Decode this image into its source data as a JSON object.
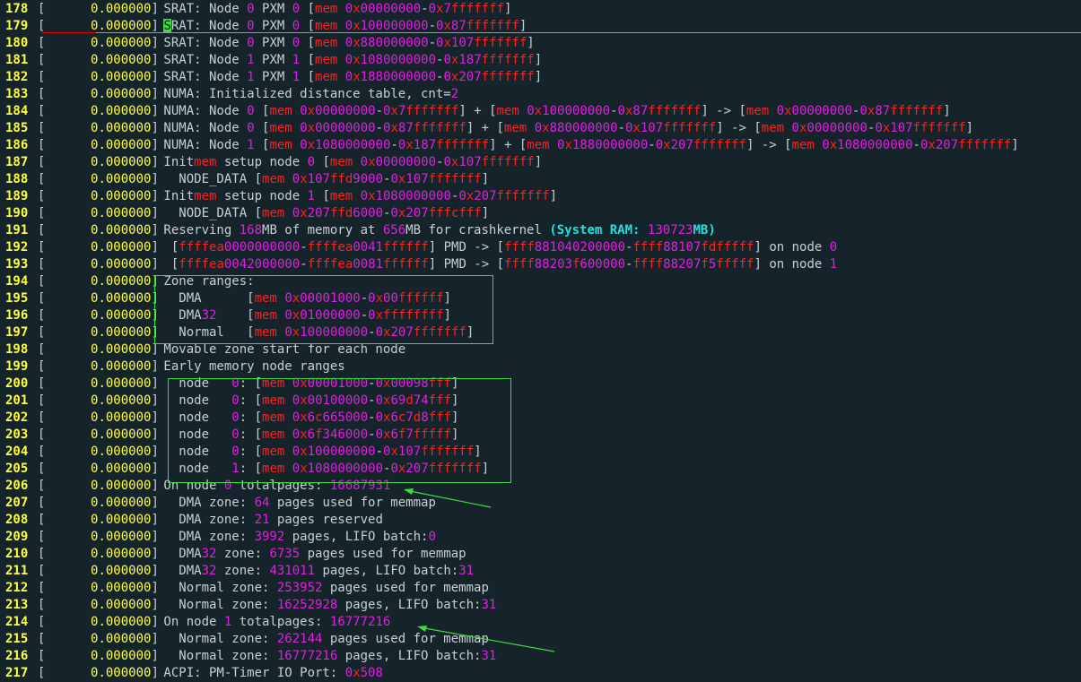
{
  "colors": {
    "background": "#15232b",
    "line_number": "#ffff44",
    "timestamp": "#ffff44",
    "text": "#c8d0d4",
    "mem_keyword": "#ff2020",
    "numeric": "#e020e0",
    "system_ram": "#20e0e0",
    "highlight_box": "#3cdc3c",
    "arrow": "#3cdc3c"
  },
  "timestamp": "0.000000",
  "lines": [
    {
      "n": "178",
      "msg": "SRAT: Node 0 PXM 0 [mem 0x00000000-0x7fffffff]"
    },
    {
      "n": "179",
      "msg": "SRAT: Node 0 PXM 0 [mem 0x100000000-0x87fffffff]",
      "cursor": true
    },
    {
      "n": "180",
      "msg": "SRAT: Node 0 PXM 0 [mem 0x880000000-0x107fffffff]"
    },
    {
      "n": "181",
      "msg": "SRAT: Node 1 PXM 1 [mem 0x1080000000-0x187fffffff]"
    },
    {
      "n": "182",
      "msg": "SRAT: Node 1 PXM 1 [mem 0x1880000000-0x207fffffff]"
    },
    {
      "n": "183",
      "msg": "NUMA: Initialized distance table, cnt=2"
    },
    {
      "n": "184",
      "msg": "NUMA: Node 0 [mem 0x00000000-0x7fffffff] + [mem 0x100000000-0x87fffffff] -> [mem 0x00000000-0x87fffffff]"
    },
    {
      "n": "185",
      "msg": "NUMA: Node 0 [mem 0x00000000-0x87fffffff] + [mem 0x880000000-0x107fffffff] -> [mem 0x00000000-0x107fffffff]"
    },
    {
      "n": "186",
      "msg": "NUMA: Node 1 [mem 0x1080000000-0x187fffffff] + [mem 0x1880000000-0x207fffffff] -> [mem 0x1080000000-0x207fffffff]"
    },
    {
      "n": "187",
      "msg": "Initmem setup node 0 [mem 0x00000000-0x107fffffff]"
    },
    {
      "n": "188",
      "msg": "  NODE_DATA [mem 0x107ffd9000-0x107fffffff]"
    },
    {
      "n": "189",
      "msg": "Initmem setup node 1 [mem 0x1080000000-0x207fffffff]"
    },
    {
      "n": "190",
      "msg": "  NODE_DATA [mem 0x207ffd6000-0x207fffcfff]"
    },
    {
      "n": "191",
      "msg": "Reserving 168MB of memory at 656MB for crashkernel (System RAM: 130723MB)"
    },
    {
      "n": "192",
      "msg": " [ffffea0000000000-ffffea0041ffffff] PMD -> [ffff881040200000-ffff88107fdfffff] on node 0"
    },
    {
      "n": "193",
      "msg": " [ffffea0042000000-ffffea0081ffffff] PMD -> [ffff88203f600000-ffff88207f5fffff] on node 1"
    },
    {
      "n": "194",
      "msg": "Zone ranges:"
    },
    {
      "n": "195",
      "msg": "  DMA      [mem 0x00001000-0x00ffffff]"
    },
    {
      "n": "196",
      "msg": "  DMA32    [mem 0x01000000-0xffffffff]"
    },
    {
      "n": "197",
      "msg": "  Normal   [mem 0x100000000-0x207fffffff]"
    },
    {
      "n": "198",
      "msg": "Movable zone start for each node"
    },
    {
      "n": "199",
      "msg": "Early memory node ranges"
    },
    {
      "n": "200",
      "msg": "  node   0: [mem 0x00001000-0x00098fff]"
    },
    {
      "n": "201",
      "msg": "  node   0: [mem 0x00100000-0x69d74fff]"
    },
    {
      "n": "202",
      "msg": "  node   0: [mem 0x6c665000-0x6c7d8fff]"
    },
    {
      "n": "203",
      "msg": "  node   0: [mem 0x6f346000-0x6f7fffff]"
    },
    {
      "n": "204",
      "msg": "  node   0: [mem 0x100000000-0x107fffffff]"
    },
    {
      "n": "205",
      "msg": "  node   1: [mem 0x1080000000-0x207fffffff]"
    },
    {
      "n": "206",
      "msg": "On node 0 totalpages: 16687931"
    },
    {
      "n": "207",
      "msg": "  DMA zone: 64 pages used for memmap"
    },
    {
      "n": "208",
      "msg": "  DMA zone: 21 pages reserved"
    },
    {
      "n": "209",
      "msg": "  DMA zone: 3992 pages, LIFO batch:0"
    },
    {
      "n": "210",
      "msg": "  DMA32 zone: 6735 pages used for memmap"
    },
    {
      "n": "211",
      "msg": "  DMA32 zone: 431011 pages, LIFO batch:31"
    },
    {
      "n": "212",
      "msg": "  Normal zone: 253952 pages used for memmap"
    },
    {
      "n": "213",
      "msg": "  Normal zone: 16252928 pages, LIFO batch:31"
    },
    {
      "n": "214",
      "msg": "On node 1 totalpages: 16777216"
    },
    {
      "n": "215",
      "msg": "  Normal zone: 262144 pages used for memmap"
    },
    {
      "n": "216",
      "msg": "  Normal zone: 16777216 pages, LIFO batch:31"
    },
    {
      "n": "217",
      "msg": "ACPI: PM-Timer IO Port: 0x508"
    }
  ]
}
